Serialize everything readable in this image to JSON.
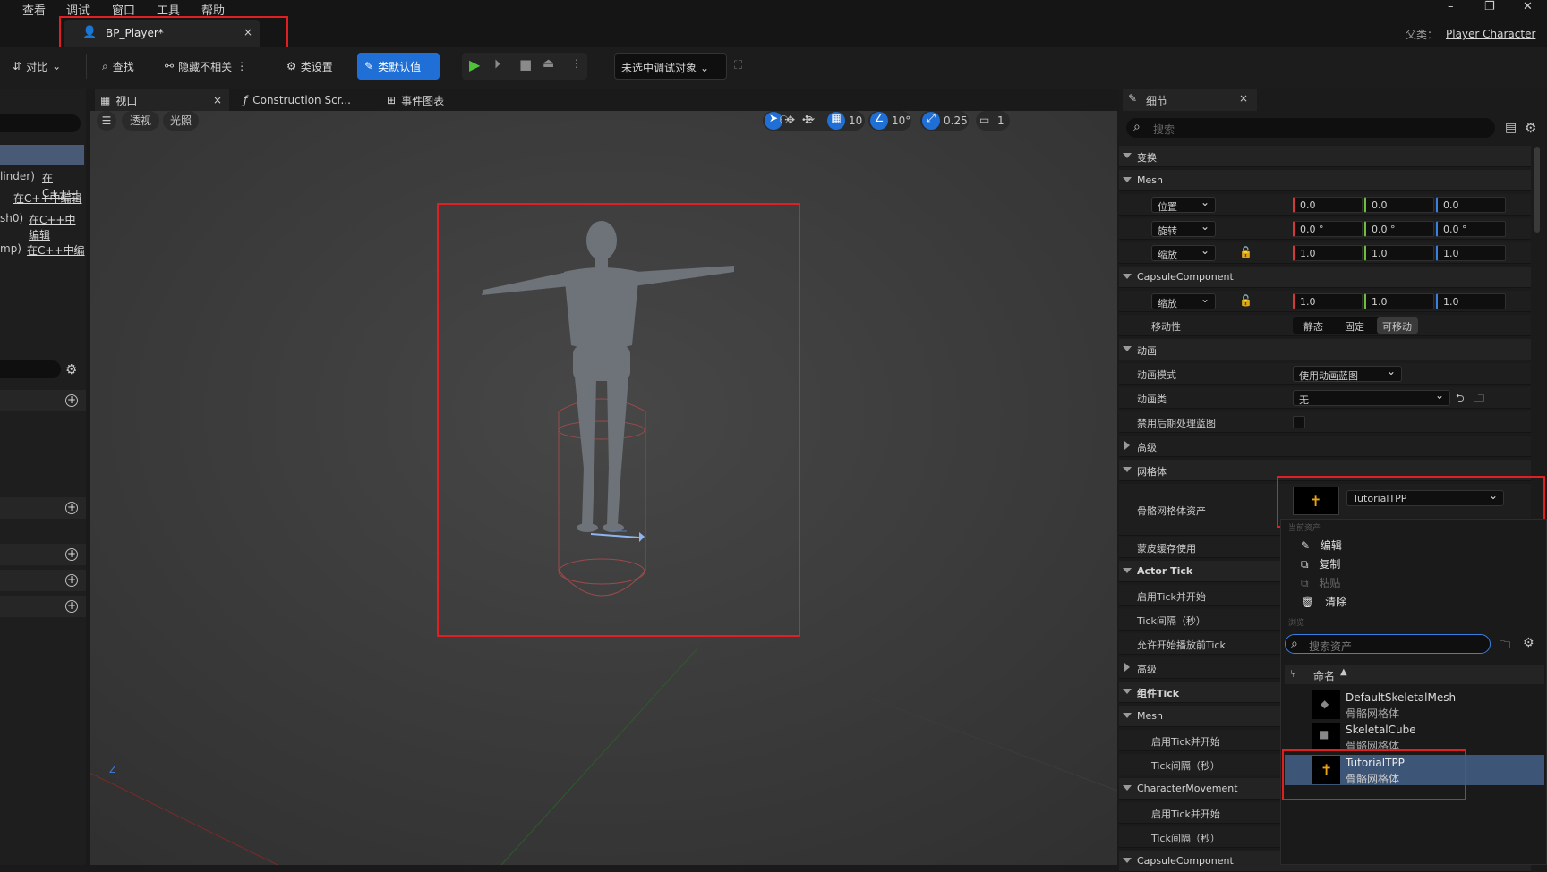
{
  "menu": [
    "查看",
    "调试",
    "窗口",
    "工具",
    "帮助"
  ],
  "window_controls": [
    "–",
    "❐",
    "✕"
  ],
  "tab": {
    "title": "BP_Player*"
  },
  "parent": {
    "label": "父类：",
    "value": "Player Character"
  },
  "toolbar": {
    "diff": "对比",
    "find": "查找",
    "hide_unrelated": "隐藏不相关",
    "class_settings": "类设置",
    "class_defaults": "类默认值",
    "debug_object": "未选中调试对象"
  },
  "left_panel": {
    "rows": [
      {
        "a": "linder)",
        "b": "在C++中"
      },
      {
        "a": "",
        "b": "在C++中编辑"
      },
      {
        "a": "sh0)",
        "b": "在C++中编辑"
      },
      {
        "a": "mp)",
        "b": "在C++中编"
      }
    ]
  },
  "viewport_tabs": [
    "视口",
    "Construction Scr...",
    "事件图表"
  ],
  "viewport": {
    "perspective": "透视",
    "lighting": "光照",
    "grid_snap": "10",
    "rot_snap": "10°",
    "scale_snap": "0.25",
    "camera_speed": "1",
    "axis_label": "Z"
  },
  "details": {
    "title": "细节",
    "search_placeholder": "搜索",
    "sections": {
      "transform": "变换",
      "mesh": "Mesh",
      "location": "位置",
      "rotation": "旋转",
      "scale": "缩放",
      "loc": [
        "0.0",
        "0.0",
        "0.0"
      ],
      "rot": [
        "0.0 °",
        "0.0 °",
        "0.0 °"
      ],
      "scl": [
        "1.0",
        "1.0",
        "1.0"
      ],
      "capsule": "CapsuleComponent",
      "capsule_scale": "缩放",
      "capsule_scl": [
        "1.0",
        "1.0",
        "1.0"
      ],
      "mobility": "移动性",
      "mobility_opts": [
        "静态",
        "固定",
        "可移动"
      ],
      "animation": "动画",
      "anim_mode": "动画模式",
      "anim_mode_value": "使用动画蓝图",
      "anim_class": "动画类",
      "anim_class_value": "无",
      "disable_post": "禁用后期处理蓝图",
      "advanced": "高级",
      "mesh_section": "网格体",
      "skel_asset": "骨骼网格体资产",
      "skel_value": "TutorialTPP",
      "skin_cache": "蒙皮缓存使用",
      "actor_tick": "Actor Tick",
      "start_tick": "启用Tick并开始",
      "tick_interval": "Tick间隔（秒）",
      "tick_before_play": "允许开始播放前Tick",
      "advanced2": "高级",
      "comp_tick": "组件Tick",
      "mesh2": "Mesh",
      "mesh2_start": "启用Tick并开始",
      "mesh2_interval": "Tick间隔（秒）",
      "charmove": "CharacterMovement",
      "cm_start": "启用Tick并开始",
      "cm_interval": "Tick间隔（秒）",
      "capsule2": "CapsuleComponent"
    }
  },
  "popup": {
    "current_asset": "当前资产",
    "edit": "编辑",
    "copy": "复制",
    "paste": "粘贴",
    "clear": "清除",
    "browse": "浏览",
    "search_placeholder": "搜索资产",
    "col_name": "命名",
    "assets": [
      {
        "name": "DefaultSkeletalMesh",
        "type": "骨骼网格体"
      },
      {
        "name": "SkeletalCube",
        "type": "骨骼网格体"
      },
      {
        "name": "TutorialTPP",
        "type": "骨骼网格体"
      }
    ]
  },
  "colors": {
    "accent": "#1f6fd6",
    "highlight": "#e02020",
    "play": "#4fc43b"
  }
}
